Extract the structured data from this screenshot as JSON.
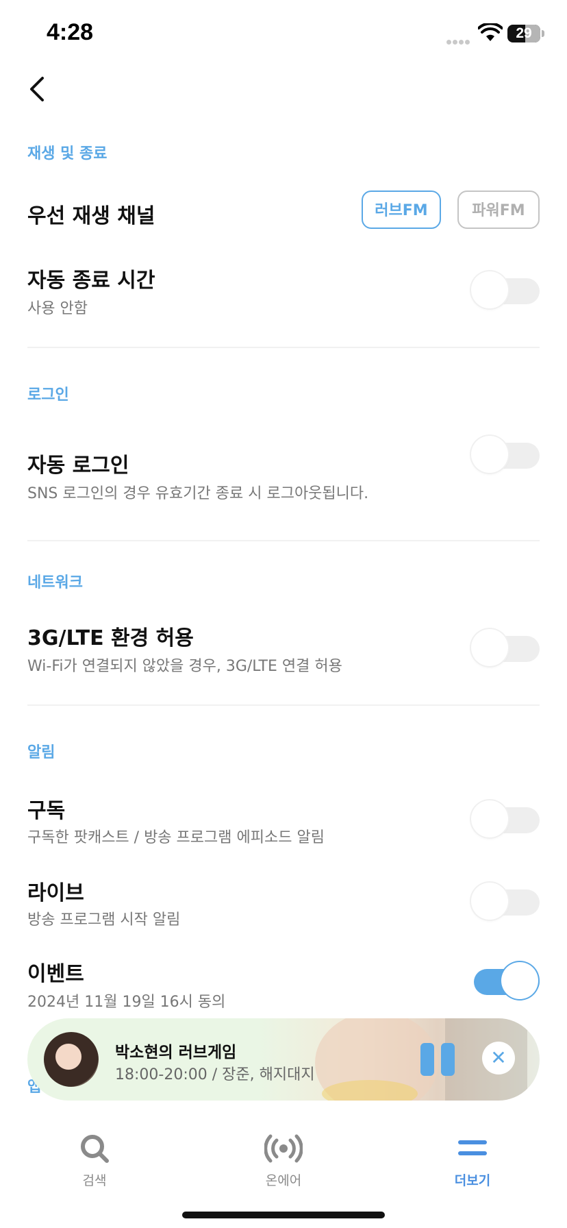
{
  "status_bar": {
    "time": "4:28",
    "battery": "29"
  },
  "sections": {
    "playback": "재생 및 종료",
    "login": "로그인",
    "network": "네트워크",
    "alerts": "알림",
    "partial_next": "앱"
  },
  "settings": {
    "priority_channel": {
      "title": "우선 재생 채널",
      "options": [
        "러브FM",
        "파워FM"
      ],
      "selected": "러브FM"
    },
    "auto_stop": {
      "title": "자동 종료 시간",
      "subtitle": "사용 안함",
      "enabled": false
    },
    "auto_login": {
      "title": "자동 로그인",
      "subtitle": "SNS 로그인의 경우 유효기간 종료 시 로그아웃됩니다.",
      "enabled": false
    },
    "lte": {
      "title": "3G/LTE 환경 허용",
      "subtitle": "Wi-Fi가 연결되지 않았을 경우, 3G/LTE 연결 허용",
      "enabled": false
    },
    "subscribe": {
      "title": "구독",
      "subtitle": "구독한 팟캐스트 / 방송 프로그램 에피소드 알림",
      "enabled": false
    },
    "live": {
      "title": "라이브",
      "subtitle": "방송 프로그램 시작 알림",
      "enabled": false
    },
    "event": {
      "title": "이벤트",
      "subtitle": "2024년 11월 19일 16시 동의",
      "enabled": true
    }
  },
  "player": {
    "title": "박소현의 러브게임",
    "subtitle": "18:00-20:00 / 장준, 해지대지"
  },
  "tabbar": {
    "items": [
      {
        "label": "검색",
        "icon": "search-icon",
        "active": false
      },
      {
        "label": "온에어",
        "icon": "broadcast-icon",
        "active": false
      },
      {
        "label": "더보기",
        "icon": "menu-icon",
        "active": true
      }
    ]
  },
  "colors": {
    "accent": "#5aa8e6",
    "tab_active": "#4a8fe0",
    "toggle_off": "#eeeeee"
  }
}
